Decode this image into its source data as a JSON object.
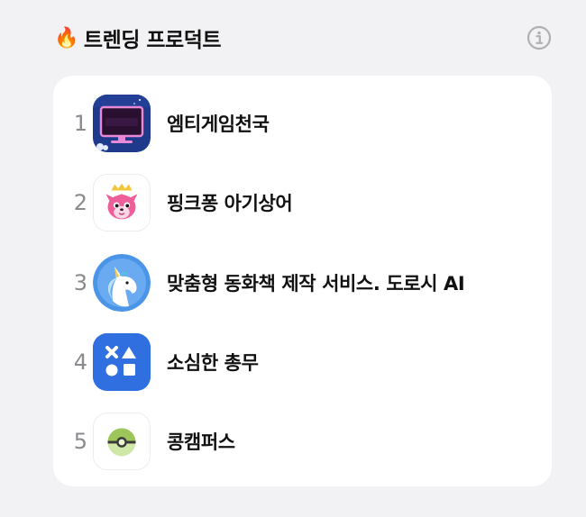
{
  "header": {
    "fire_glyph": "🔥",
    "title": "트렌딩 프로덕트",
    "info_icon": "info-icon"
  },
  "products": [
    {
      "rank": "1",
      "name": "엠티게임천국",
      "icon": "tv-screen-app-icon",
      "icon_label": "엠티게임천국"
    },
    {
      "rank": "2",
      "name": "핑크퐁 아기상어",
      "icon": "pink-fox-app-icon"
    },
    {
      "rank": "3",
      "name": "맞춤형 동화책 제작 서비스. 도로시 AI",
      "icon": "unicorn-app-icon"
    },
    {
      "rank": "4",
      "name": "소심한 총무",
      "icon": "shapes-app-icon"
    },
    {
      "rank": "5",
      "name": "콩캠퍼스",
      "icon": "green-ball-app-icon"
    }
  ],
  "colors": {
    "background": "#f2f2f4",
    "card": "#ffffff",
    "rank_text": "#8a8a8e",
    "shapes_icon_blue": "#2f6fe0",
    "unicorn_icon_blue": "#4a95e8"
  }
}
